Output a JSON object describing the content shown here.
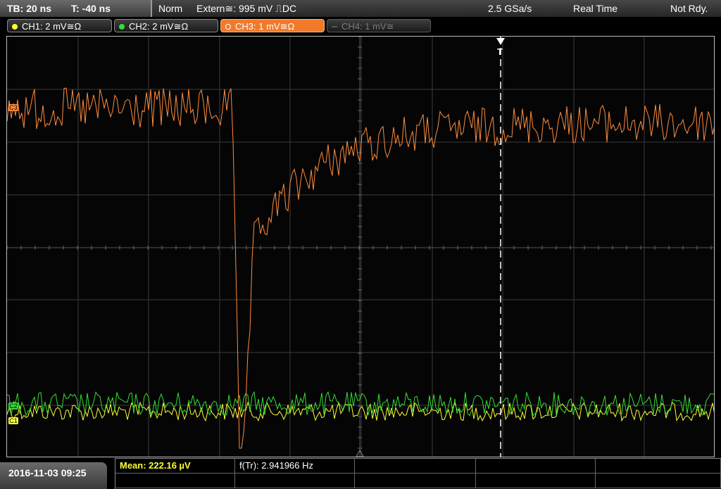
{
  "status_bar": {
    "timebase": "TB: 20 ns",
    "trigger_time": "T: -40 ns",
    "trigger_mode": "Norm",
    "trigger_source": "Extern≅: 995 mV ⎍DC",
    "sample_rate": "2.5 GSa/s",
    "acquisition": "Real Time",
    "state": "Not Rdy."
  },
  "channels": [
    {
      "label": "CH1: 2 mV≅Ω",
      "color": "#ffff33",
      "state": "on"
    },
    {
      "label": "CH2: 2 mV≅Ω",
      "color": "#33dd33",
      "state": "on"
    },
    {
      "label": "CH3: 1 mV≅Ω",
      "color": "#ff8c3c",
      "state": "selected"
    },
    {
      "label": "CH4: 1 mV≅",
      "color": "#8a8a8a",
      "state": "off"
    }
  ],
  "screen": {
    "trigger_marker": "T",
    "ch3_marker": "C3",
    "ch2_marker": "C2",
    "ch1_marker": "C1"
  },
  "measurements": {
    "mean": "Mean: 222.16 µV",
    "frequency": "f(Tr): 2.941966 Hz"
  },
  "datetime": "2016-11-03 09:25"
}
